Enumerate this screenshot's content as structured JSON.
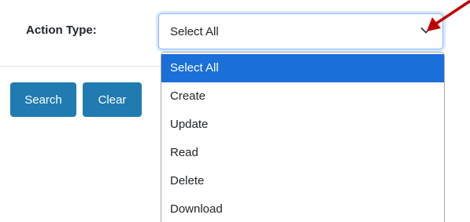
{
  "filter": {
    "label": "Action Type:",
    "selected_value": "Select All"
  },
  "buttons": {
    "search_label": "Search",
    "clear_label": "Clear"
  },
  "dropdown": {
    "options": [
      {
        "label": "Select All",
        "selected": true
      },
      {
        "label": "Create",
        "selected": false
      },
      {
        "label": "Update",
        "selected": false
      },
      {
        "label": "Read",
        "selected": false
      },
      {
        "label": "Delete",
        "selected": false
      },
      {
        "label": "Download",
        "selected": false
      }
    ]
  },
  "icons": {
    "dropdown_toggle": "chevron-down-icon",
    "annotation": "red-arrow-icon"
  },
  "colors": {
    "button_bg": "#1f7bb0",
    "selected_option_bg": "#1a6fd8",
    "annotation_arrow": "#c00000"
  }
}
